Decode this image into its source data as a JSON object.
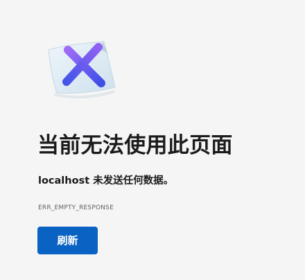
{
  "error_page": {
    "illustration_icon": "broken-page-x-icon",
    "title": "当前无法使用此页面",
    "summary": "localhost 未发送任何数据。",
    "error_code": "ERR_EMPTY_RESPONSE",
    "reload_label": "刷新"
  },
  "colors": {
    "background": "#f5f5f5",
    "button": "#0a62c2",
    "button_text": "#ffffff",
    "x_gradient_start": "#8a5cf0",
    "x_gradient_end": "#3f4fe6",
    "paper": "#dbe9f2"
  }
}
